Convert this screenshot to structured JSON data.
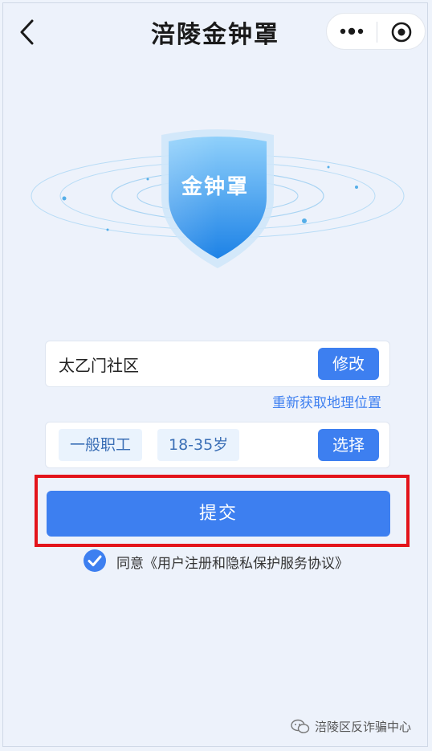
{
  "header": {
    "title": "涪陵金钟罩"
  },
  "emblem": {
    "label": "金钟罩"
  },
  "location": {
    "value": "太乙门社区",
    "modify_label": "修改",
    "relocate_label": "重新获取地理位置"
  },
  "category": {
    "job": "一般职工",
    "age": "18-35岁",
    "select_label": "选择"
  },
  "submit": {
    "label": "提交"
  },
  "agreement": {
    "prefix": "同意",
    "link": "《用户注册和隐私保护服务协议》",
    "checked": true
  },
  "watermark": {
    "text": "涪陵区反诈骗中心"
  },
  "colors": {
    "accent": "#3d7ff0",
    "highlight": "#e3141b",
    "background": "#edf2fb"
  },
  "icons": [
    "back-chevron-icon",
    "more-dots-icon",
    "target-icon",
    "shield-icon",
    "checkmark-icon",
    "wechat-logo-icon"
  ]
}
